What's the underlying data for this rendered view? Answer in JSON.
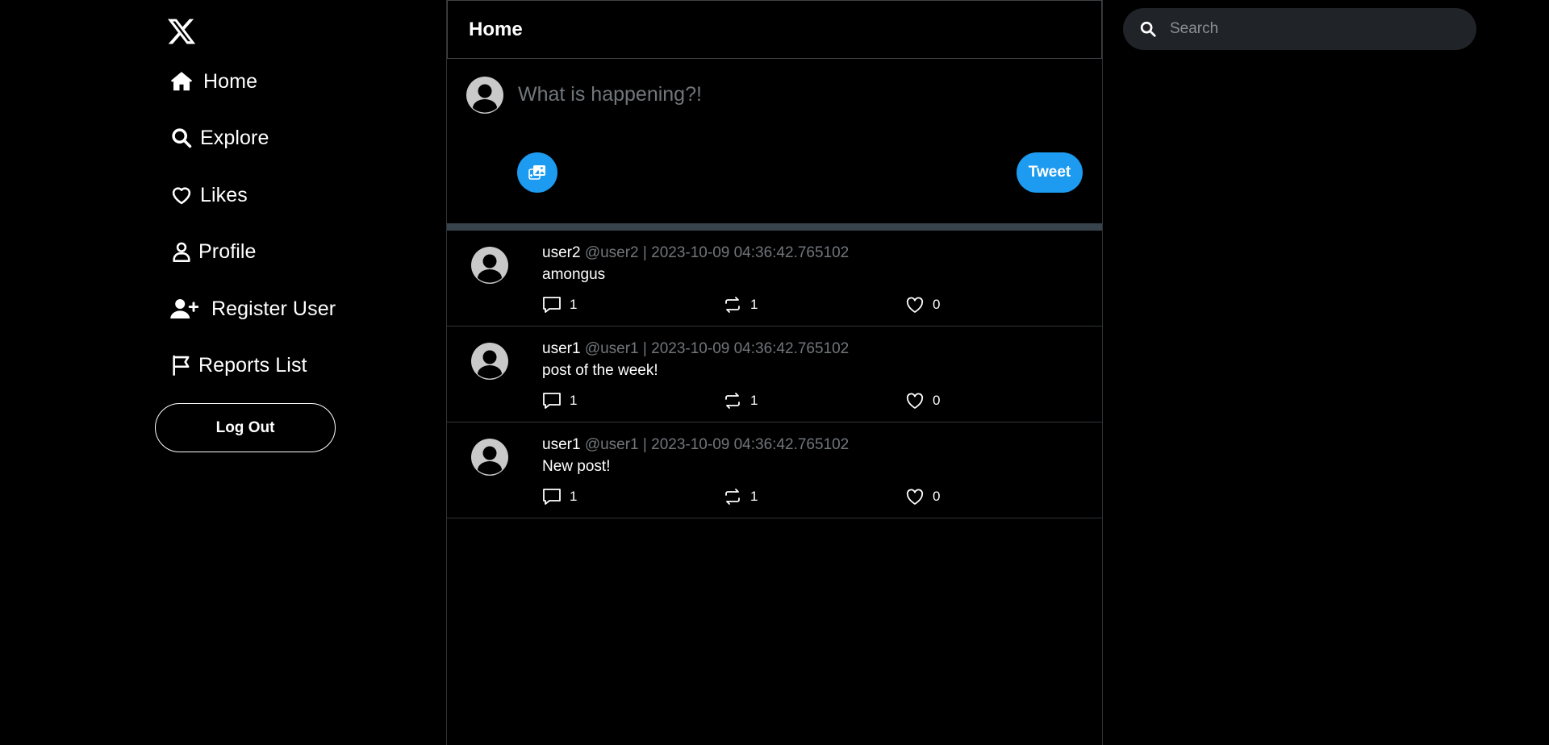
{
  "sidebar": {
    "logo_icon": "x-logo-icon",
    "items": [
      {
        "label": "Home",
        "icon": "home-icon"
      },
      {
        "label": "Explore",
        "icon": "search-icon"
      },
      {
        "label": "Likes",
        "icon": "heart-icon"
      },
      {
        "label": "Profile",
        "icon": "user-icon"
      },
      {
        "label": "Register User",
        "icon": "user-plus-icon"
      },
      {
        "label": "Reports List",
        "icon": "flag-icon"
      }
    ],
    "logout_label": "Log Out"
  },
  "main": {
    "title": "Home",
    "compose": {
      "placeholder": "What is happening?!",
      "tweet_label": "Tweet",
      "media_icon": "image-upload-icon"
    },
    "posts": [
      {
        "username": "user2",
        "handle": "@user2",
        "separator": "|",
        "timestamp": "2023-10-09 04:36:42.765102",
        "text": "amongus",
        "replies": "1",
        "retweets": "1",
        "likes": "0"
      },
      {
        "username": "user1",
        "handle": "@user1",
        "separator": "|",
        "timestamp": "2023-10-09 04:36:42.765102",
        "text": "post of the week!",
        "replies": "1",
        "retweets": "1",
        "likes": "0"
      },
      {
        "username": "user1",
        "handle": "@user1",
        "separator": "|",
        "timestamp": "2023-10-09 04:36:42.765102",
        "text": "New post!",
        "replies": "1",
        "retweets": "1",
        "likes": "0"
      }
    ]
  },
  "search": {
    "placeholder": "Search"
  },
  "colors": {
    "background": "#000000",
    "accent": "#1d9bf0",
    "muted_text": "#71767b",
    "divider": "#38444d",
    "search_bg": "#202327"
  }
}
